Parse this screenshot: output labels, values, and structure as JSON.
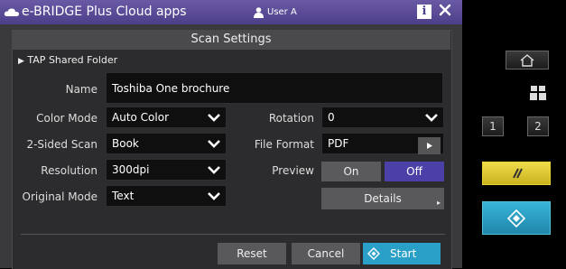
{
  "app": {
    "title": "e-BRIDGE Plus Cloud apps",
    "user": "User A",
    "info_label": "i"
  },
  "panel": {
    "title": "Scan Settings",
    "breadcrumb": "TAP Shared Folder"
  },
  "form": {
    "name_label": "Name",
    "name_value": "Toshiba One brochure",
    "color_mode_label": "Color Mode",
    "color_mode_value": "Auto Color",
    "two_sided_label": "2-Sided Scan",
    "two_sided_value": "Book",
    "resolution_label": "Resolution",
    "resolution_value": "300dpi",
    "original_mode_label": "Original Mode",
    "original_mode_value": "Text",
    "rotation_label": "Rotation",
    "rotation_value": "0",
    "file_format_label": "File Format",
    "file_format_value": "PDF",
    "preview_label": "Preview",
    "preview_on": "On",
    "preview_off": "Off",
    "preview_selected": "Off",
    "details_label": "Details"
  },
  "footer": {
    "reset_label": "Reset",
    "cancel_label": "Cancel",
    "start_label": "Start"
  },
  "hardware": {
    "key1": "1",
    "key2": "2"
  },
  "colors": {
    "appbar": "#5a4a99",
    "selected": "#4a40a8",
    "start": "#2aa0c8",
    "yellow": "#e8d233",
    "hw_start": "#2b9cc0"
  },
  "icons": [
    "cloud-icon",
    "user-icon",
    "info-icon",
    "close-icon",
    "chevron-down-icon",
    "home-icon",
    "people-icon",
    "clear-icon",
    "start-diamond-icon"
  ]
}
